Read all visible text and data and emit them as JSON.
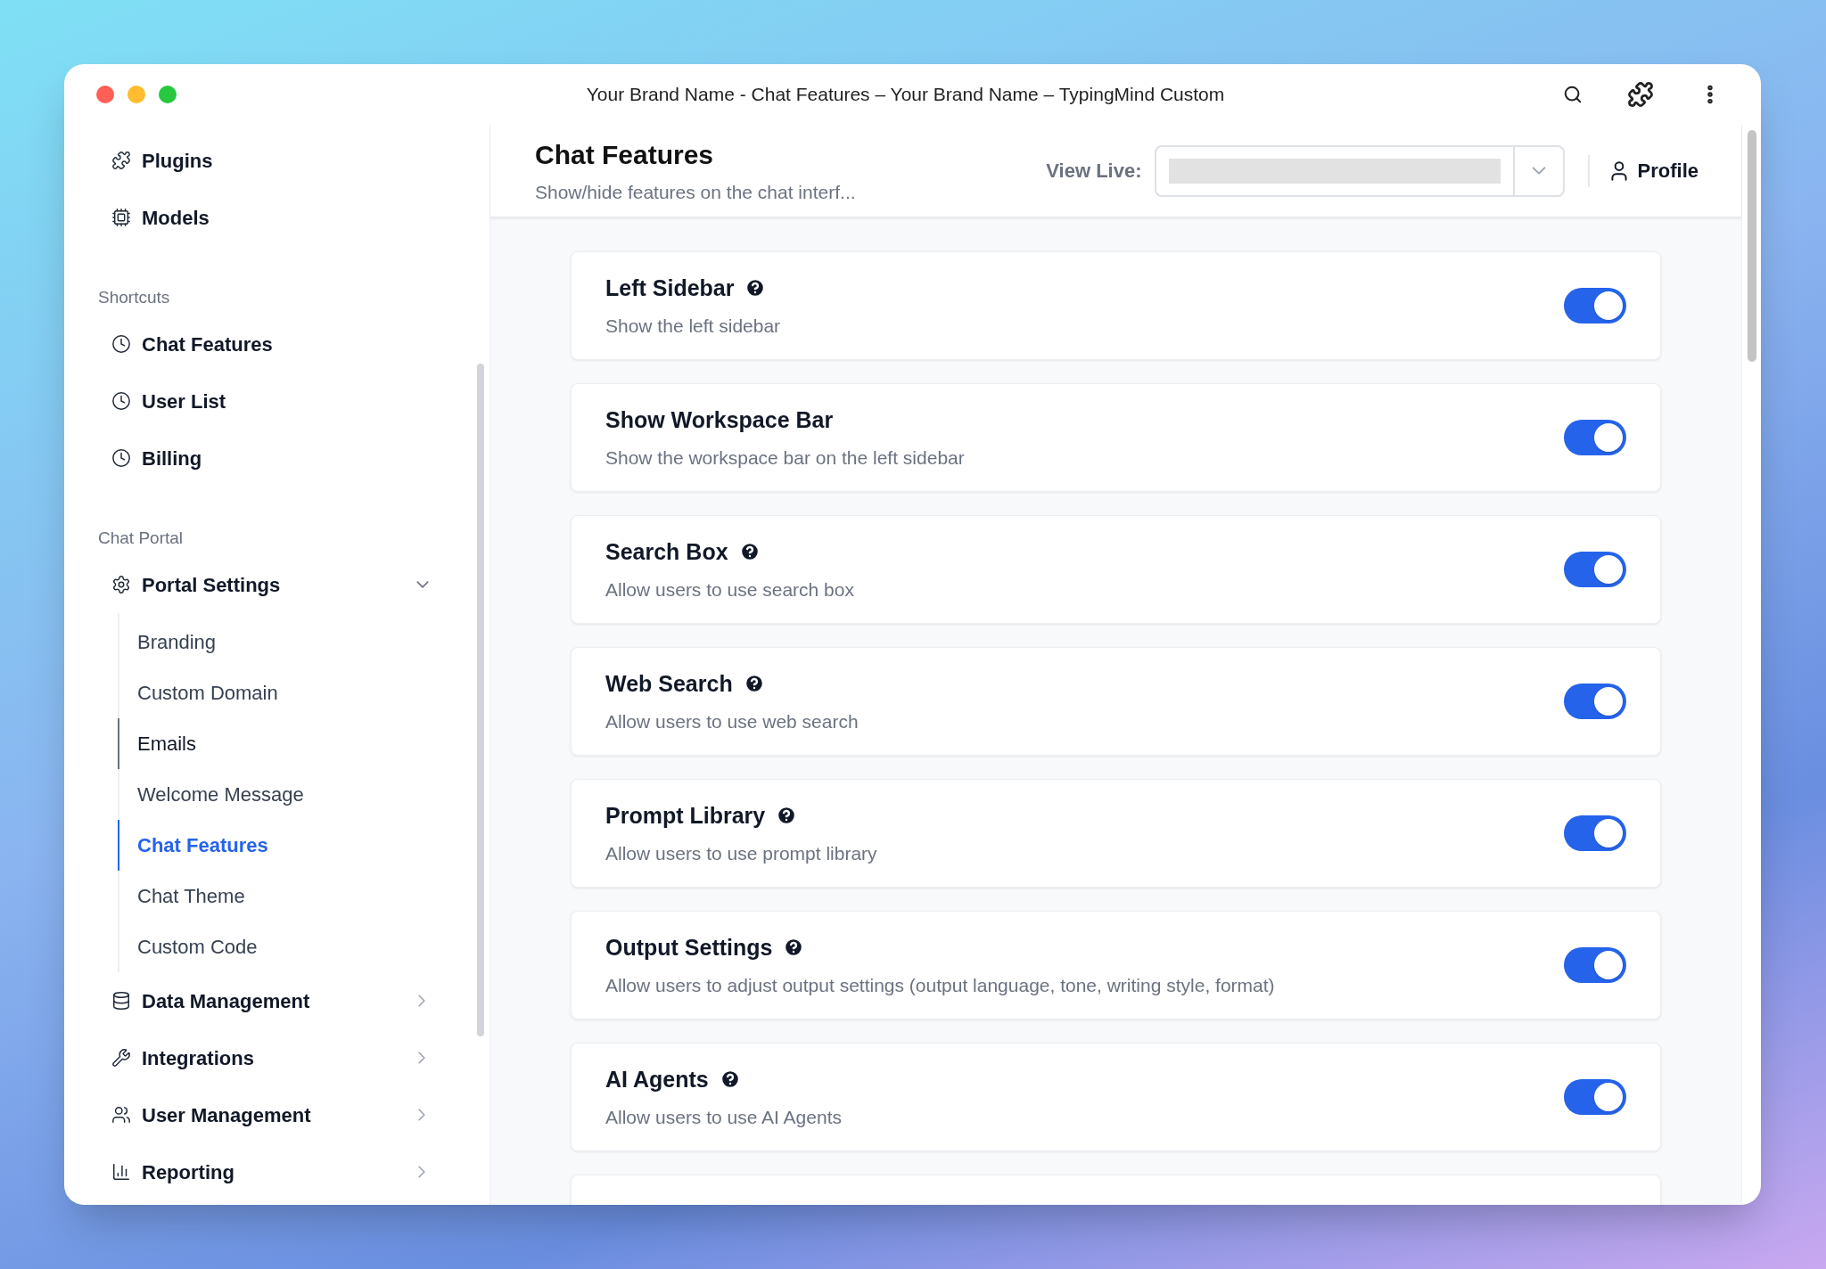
{
  "window": {
    "title": "Your Brand Name - Chat Features – Your Brand Name – TypingMind Custom"
  },
  "sidebar": {
    "top_items": [
      {
        "label": "Plugins"
      },
      {
        "label": "Models"
      }
    ],
    "sections": [
      {
        "heading": "Shortcuts",
        "items": [
          {
            "label": "Chat Features"
          },
          {
            "label": "User List"
          },
          {
            "label": "Billing"
          }
        ]
      },
      {
        "heading": "Chat Portal",
        "items": [
          {
            "label": "Portal Settings",
            "expanded": true,
            "children": [
              {
                "label": "Branding",
                "selected": false,
                "hovered": false
              },
              {
                "label": "Custom Domain",
                "selected": false,
                "hovered": false
              },
              {
                "label": "Emails",
                "selected": false,
                "hovered": true
              },
              {
                "label": "Welcome Message",
                "selected": false,
                "hovered": false
              },
              {
                "label": "Chat Features",
                "selected": true,
                "hovered": false
              },
              {
                "label": "Chat Theme",
                "selected": false,
                "hovered": false
              },
              {
                "label": "Custom Code",
                "selected": false,
                "hovered": false
              }
            ]
          },
          {
            "label": "Data Management",
            "expanded": false
          },
          {
            "label": "Integrations",
            "expanded": false
          },
          {
            "label": "User Management",
            "expanded": false
          },
          {
            "label": "Reporting",
            "expanded": false
          }
        ]
      }
    ]
  },
  "header": {
    "title": "Chat Features",
    "subtitle": "Show/hide features on the chat interf...",
    "view_live_label": "View Live:",
    "profile_label": "Profile"
  },
  "features": [
    {
      "title": "Left Sidebar",
      "help": true,
      "description": "Show the left sidebar",
      "on": true
    },
    {
      "title": "Show Workspace Bar",
      "help": false,
      "description": "Show the workspace bar on the left sidebar",
      "on": true
    },
    {
      "title": "Search Box",
      "help": true,
      "description": "Allow users to use search box",
      "on": true
    },
    {
      "title": "Web Search",
      "help": true,
      "description": "Allow users to use web search",
      "on": true
    },
    {
      "title": "Prompt Library",
      "help": true,
      "description": "Allow users to use prompt library",
      "on": true
    },
    {
      "title": "Output Settings",
      "help": true,
      "description": "Allow users to adjust output settings (output language, tone, writing style, format)",
      "on": true
    },
    {
      "title": "AI Agents",
      "help": true,
      "description": "Allow users to use AI Agents",
      "on": true
    }
  ]
}
